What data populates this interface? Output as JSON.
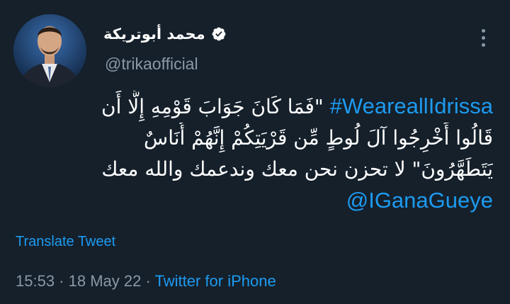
{
  "author": {
    "display_name": "محمد أبوتريكة",
    "handle": "@trikaofficial",
    "verified": true
  },
  "icons": {
    "avatar": "profile-photo",
    "verified": "verified-badge-icon",
    "more": "more-options-icon"
  },
  "tweet": {
    "hashtag": "#WeareallIdrissa",
    "line1_text": "\"فَمَا كَانَ جَوَابَ قَوْمِهِ إِلَّا أَن",
    "line2_text": "قَالُوا أَخْرِجُوا آلَ لُوطٍ مِّن قَرْيَتِكُمْ إِنَّهُمْ أُنَاسٌ",
    "line3_text": "يَتَطَهَّرُونَ\" لا تحزن نحن معك وندعمك والله معك",
    "mention": "@IGanaGueye"
  },
  "actions": {
    "translate_label": "Translate Tweet"
  },
  "meta": {
    "time": "15:53",
    "separator": " · ",
    "date": "18 May 22",
    "source": "Twitter for iPhone"
  },
  "colors": {
    "background": "#15202b",
    "primary_text": "#ffffff",
    "secondary_text": "#8b98a5",
    "accent": "#1d9bf0"
  }
}
